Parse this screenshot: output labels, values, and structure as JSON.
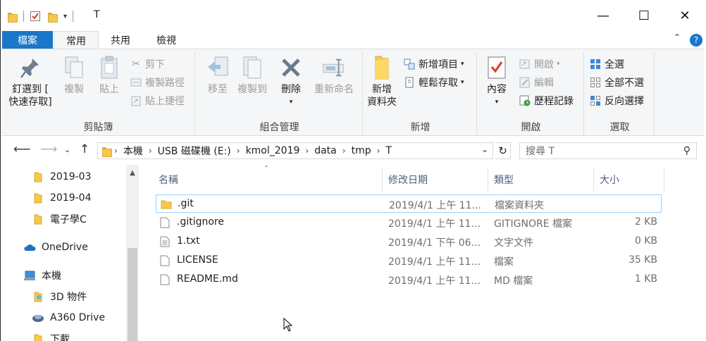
{
  "window": {
    "title": "T",
    "controls": {
      "minimize": "—",
      "maximize": "☐",
      "close": "✕"
    }
  },
  "tabs": [
    {
      "label": "檔案"
    },
    {
      "label": "常用"
    },
    {
      "label": "共用"
    },
    {
      "label": "檢視"
    }
  ],
  "ribbon": {
    "clipboard": {
      "label": "剪貼簿",
      "pin": "釘選到 [\n快速存取]",
      "copy": "複製",
      "paste": "貼上",
      "cut": "剪下",
      "copy_path": "複製路徑",
      "paste_shortcut": "貼上捷徑"
    },
    "organize": {
      "label": "組合管理",
      "move_to": "移至",
      "copy_to": "複製到",
      "delete": "刪除",
      "rename": "重新命名"
    },
    "new": {
      "label": "新增",
      "new_folder": "新增\n資料夾",
      "new_item": "新增項目",
      "easy_access": "輕鬆存取"
    },
    "open": {
      "label": "開啟",
      "properties": "內容",
      "open": "開啟",
      "edit": "編輯",
      "history": "歷程記錄"
    },
    "select": {
      "label": "選取",
      "select_all": "全選",
      "select_none": "全部不選",
      "invert": "反向選擇"
    }
  },
  "address": {
    "crumbs": [
      "本機",
      "USB 磁碟機 (E:)",
      "kmol_2019",
      "data",
      "tmp",
      "T"
    ]
  },
  "search": {
    "placeholder": "搜尋 T"
  },
  "nav_tree": [
    {
      "label": "2019-03",
      "icon": "folder-icon"
    },
    {
      "label": "2019-04",
      "icon": "folder-icon"
    },
    {
      "label": "電子學C",
      "icon": "folder-icon"
    },
    {
      "label": "OneDrive",
      "icon": "cloud-icon"
    },
    {
      "label": "本機",
      "icon": "computer-icon"
    },
    {
      "label": "3D 物件",
      "icon": "3d-objects-icon"
    },
    {
      "label": "A360 Drive",
      "icon": "a360-icon"
    },
    {
      "label": "下載",
      "icon": "download-icon"
    }
  ],
  "columns": {
    "name": "名稱",
    "modified": "修改日期",
    "type": "類型",
    "size": "大小"
  },
  "files": [
    {
      "name": ".git",
      "modified": "2019/4/1 上午 11...",
      "type": "檔案資料夾",
      "size": "",
      "icon": "folder-icon"
    },
    {
      "name": ".gitignore",
      "modified": "2019/4/1 上午 11...",
      "type": "GITIGNORE 檔案",
      "size": "2 KB",
      "icon": "file-icon"
    },
    {
      "name": "1.txt",
      "modified": "2019/4/1 下午 06...",
      "type": "文字文件",
      "size": "0 KB",
      "icon": "text-file-icon"
    },
    {
      "name": "LICENSE",
      "modified": "2019/4/1 上午 11...",
      "type": "檔案",
      "size": "35 KB",
      "icon": "file-icon"
    },
    {
      "name": "README.md",
      "modified": "2019/4/1 上午 11...",
      "type": "MD 檔案",
      "size": "1 KB",
      "icon": "file-icon"
    }
  ],
  "colors": {
    "file_tab": "#1a76c8",
    "folder": "#f6c94d",
    "selection_border": "#99d1ff"
  }
}
